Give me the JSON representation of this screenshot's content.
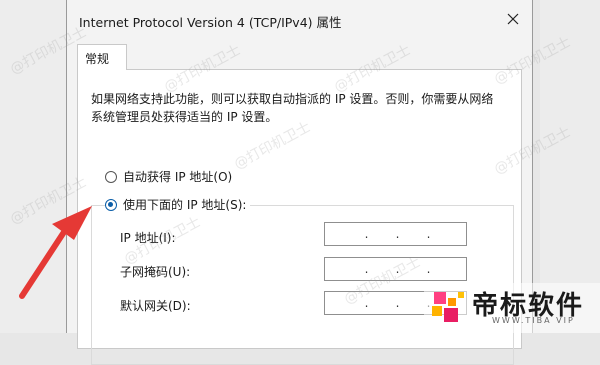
{
  "window": {
    "title": "Internet Protocol Version 4 (TCP/IPv4) 属性"
  },
  "tab": {
    "label": "常规"
  },
  "description": "如果网络支持此功能，则可以获取自动指派的 IP 设置。否则，你需要从网络系统管理员处获得适当的 IP 设置。",
  "options": {
    "auto_ip": "自动获得 IP 地址(O)",
    "manual_ip": "使用下面的 IP 地址(S):",
    "selected": "manual_ip"
  },
  "fields": {
    "ip_label": "IP 地址(I):",
    "subnet_label": "子网掩码(U):",
    "gateway_label": "默认网关(D):",
    "dots": "."
  },
  "watermark": {
    "text": "@打印机卫士"
  },
  "logo": {
    "text": "帝标软件",
    "sub": "WWW.TIBA VIP"
  },
  "colors": {
    "arrow": "#e53935",
    "radio_selected": "#0b5ea8",
    "logo_accent": "#ff4081"
  }
}
